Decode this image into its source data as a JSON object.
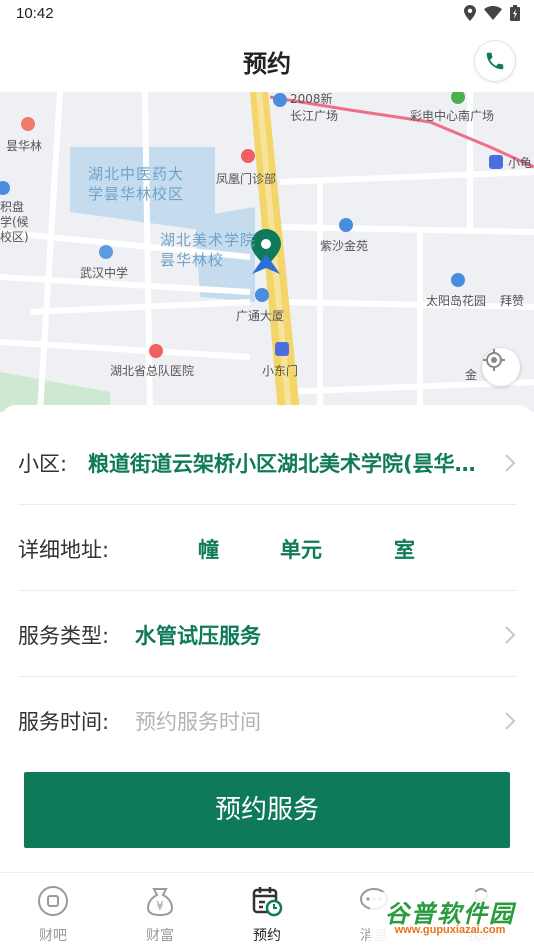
{
  "status_bar": {
    "time": "10:42"
  },
  "header": {
    "title": "预约"
  },
  "map": {
    "labels": {
      "changjiang": "2008新\n长江广场",
      "caidian": "彩电中心南广场",
      "xiaogui": "小龟",
      "yuhualin": "昙华林",
      "hubei_tcm": "湖北中医药大\n学昙华林校区",
      "fenghuangmen": "凤凰门诊部",
      "jipan": "积盘\n学(候\n校区)",
      "hubei_art": "湖北美术学院\n昙华林校",
      "zisha": "紫沙金苑",
      "wuhan_middle": "武汉中学",
      "guangtong": "广通大厦",
      "taiyangdao": "太阳岛花园",
      "baizan": "拜赞",
      "hubei_hospital": "湖北省总队医院",
      "xiaodongmen": "小东门",
      "jin": "金"
    }
  },
  "form": {
    "community_label": "小区:",
    "community_value": "粮道街道云架桥小区湖北美术学院(昙华林校区)",
    "address_label": "详细地址:",
    "address_building": "幢",
    "address_unit": "单元",
    "address_room": "室",
    "service_type_label": "服务类型:",
    "service_type_value": "水管试压服务",
    "service_time_label": "服务时间:",
    "service_time_placeholder": "预约服务时间",
    "submit_label": "预约服务"
  },
  "tabs": [
    {
      "label": "财吧",
      "icon": "coin-icon"
    },
    {
      "label": "财富",
      "icon": "money-bag-icon"
    },
    {
      "label": "预约",
      "icon": "calendar-clock-icon"
    },
    {
      "label": "消息",
      "icon": "message-icon"
    },
    {
      "label": "我的",
      "icon": "user-icon"
    }
  ],
  "watermark": {
    "title": "谷普软件园",
    "url": "www.gupuxiazai.com"
  },
  "colors": {
    "accent": "#0f7a5a",
    "placeholder": "#b3b3b3"
  }
}
